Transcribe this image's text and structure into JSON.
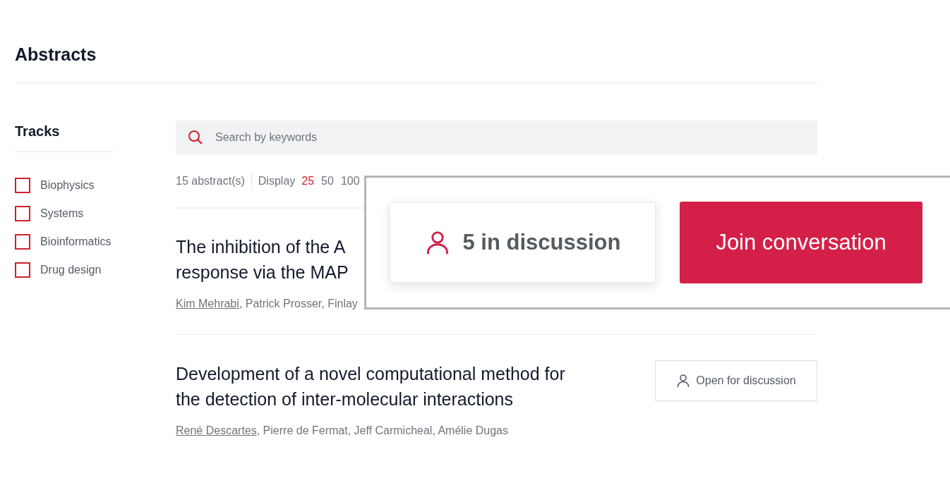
{
  "page_title": "Abstracts",
  "sidebar": {
    "title": "Tracks",
    "tracks": [
      {
        "label": "Biophysics",
        "checked": false
      },
      {
        "label": "Systems",
        "checked": false
      },
      {
        "label": "Bioinformatics",
        "checked": false
      },
      {
        "label": "Drug design",
        "checked": false
      }
    ]
  },
  "search": {
    "placeholder": "Search by keywords"
  },
  "results": {
    "count": "15 abstract(s)",
    "display_label": "Display",
    "page_sizes": [
      {
        "label": "25",
        "selected": true
      },
      {
        "label": "50",
        "selected": false
      },
      {
        "label": "100",
        "selected": false
      }
    ]
  },
  "abstracts": [
    {
      "title_lines": [
        "The inhibition of the A",
        "response via the MAP"
      ],
      "lead_author": "Kim Mehrabi",
      "other_authors": ", Patrick Prosser, Finlay"
    },
    {
      "title_lines": [
        "Development of a novel computational method for",
        "the detection of inter-molecular interactions"
      ],
      "lead_author": "René Descartes",
      "other_authors": ", Pierre de Fermat, Jeff Carmicheal, Amélie Dugas",
      "discussion_button": "Open for discussion"
    }
  ],
  "callout": {
    "participants": "5 in discussion",
    "button": "Join conversation"
  }
}
